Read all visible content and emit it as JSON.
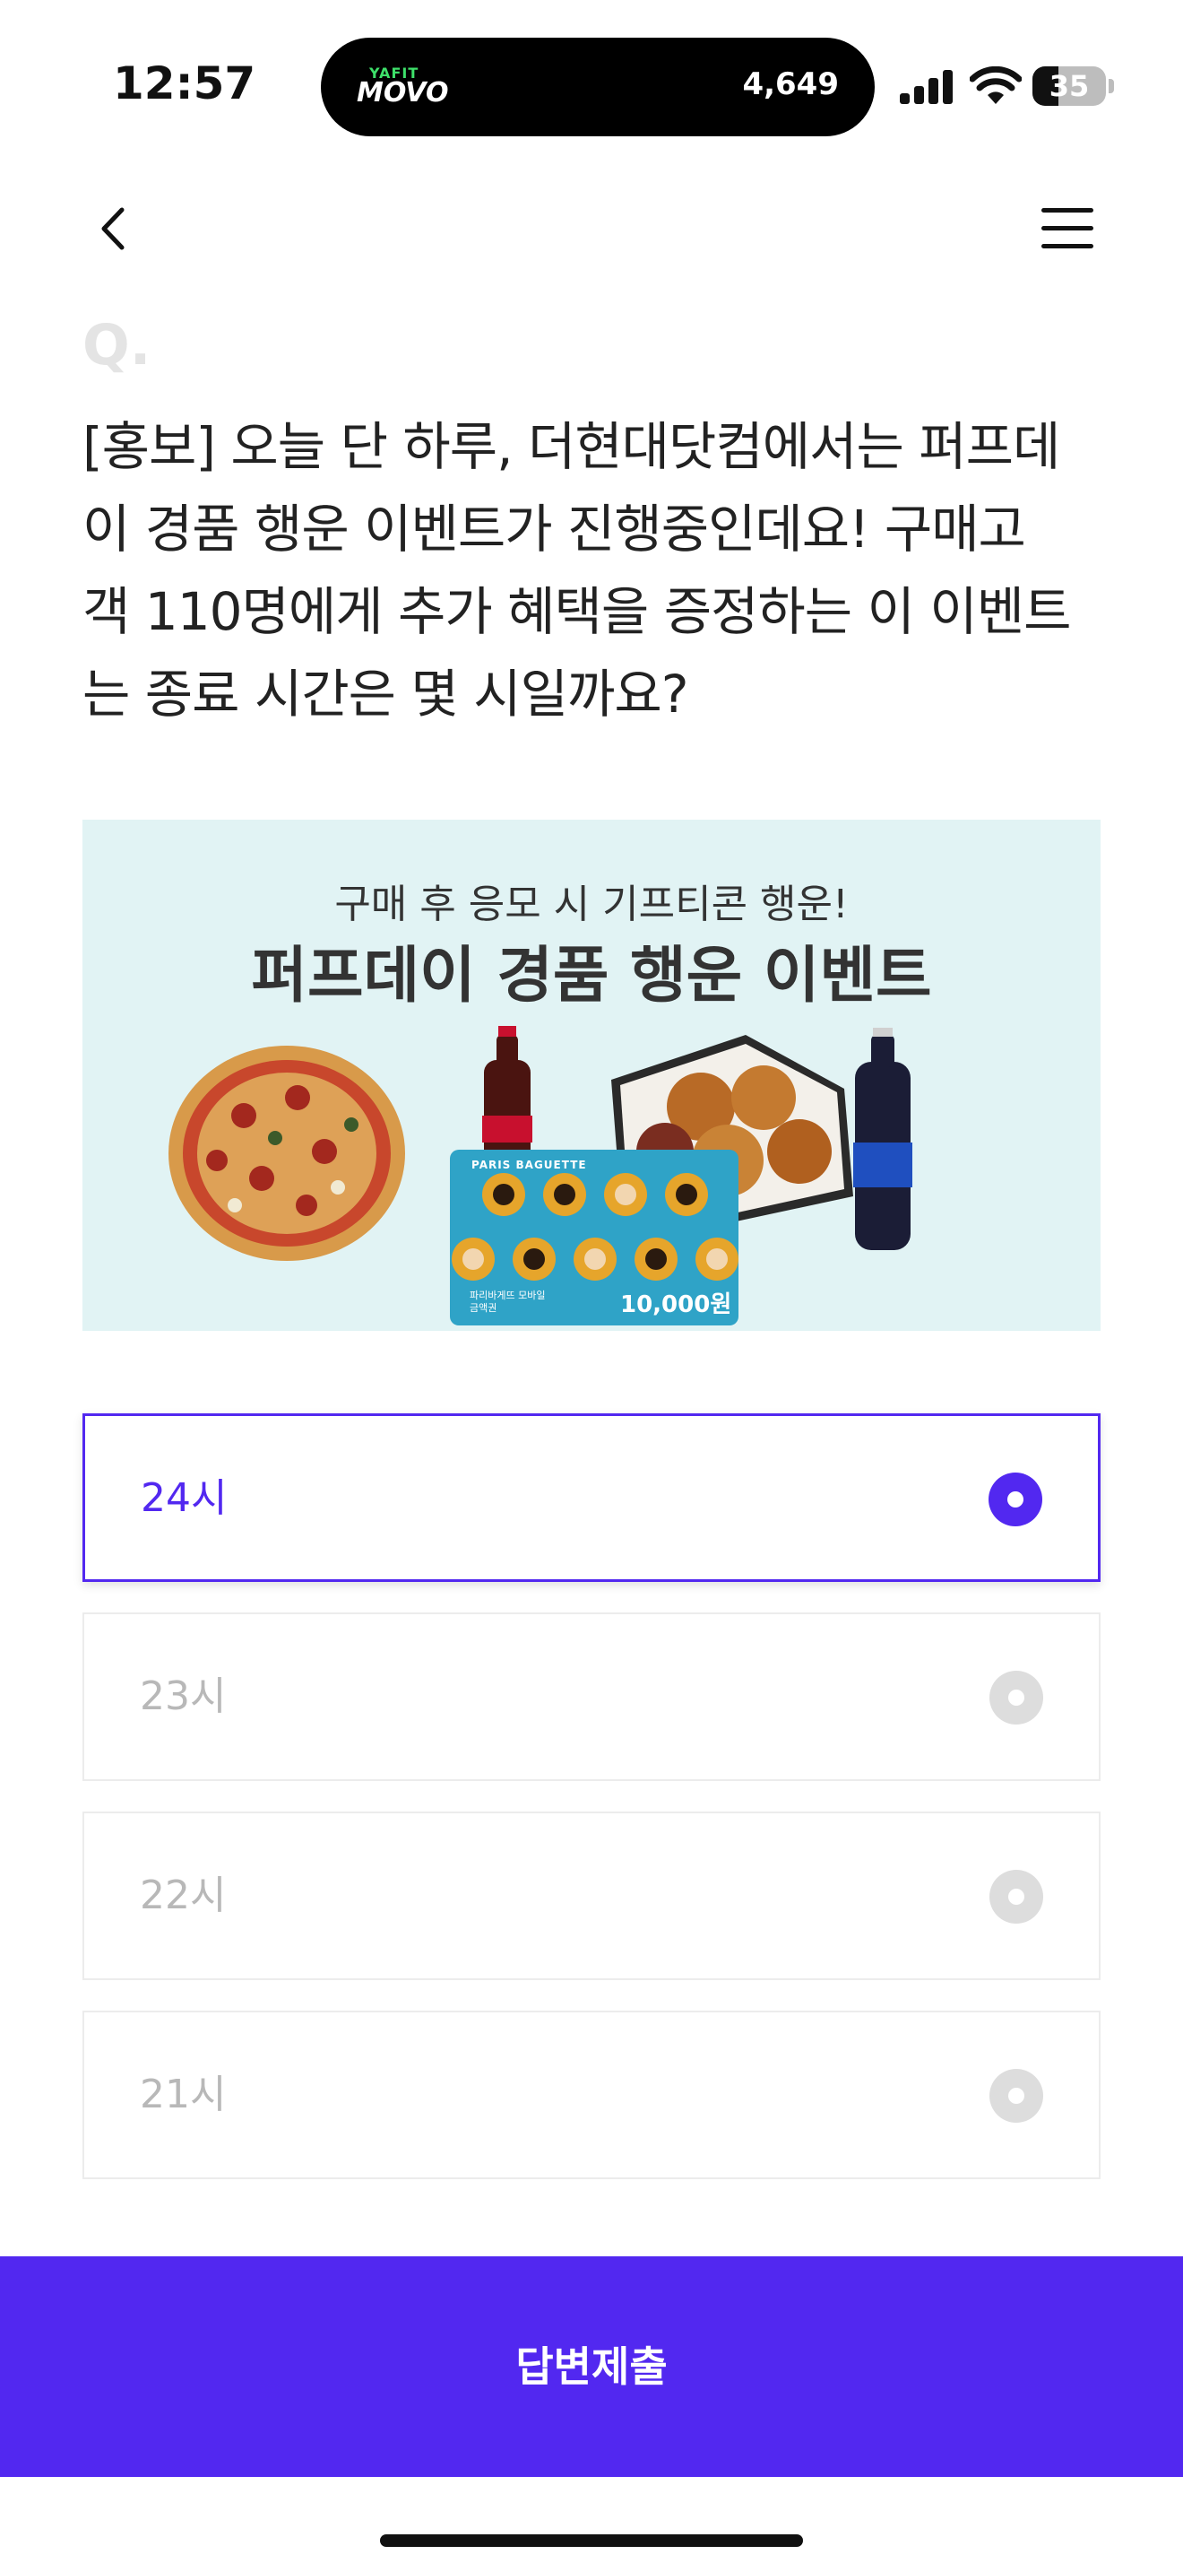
{
  "status_bar": {
    "time": "12:57",
    "island_app": {
      "badge": "YAFIT",
      "name": "MOVO"
    },
    "steps": "4,649",
    "battery_level": "35",
    "battery_fraction": 0.35
  },
  "nav": {
    "back_icon": "chevron-left-icon",
    "menu_icon": "hamburger-menu-icon"
  },
  "question": {
    "marker": "Q.",
    "lines": [
      "[홍보] 오늘 단 하루, 더현대닷컴에서는 퍼프데",
      "이 경품 행운 이벤트가 진행중인데요! 구매고",
      "객 110명에게 추가 혜택을 증정하는 이 이벤트",
      "는 종료 시간은 몇 시일까요?"
    ]
  },
  "banner": {
    "subtitle": "구매 후 응모 시 기프티콘 행운!",
    "title": "퍼프데이 경품 행운 이벤트",
    "voucher_brand": "PARIS BAGUETTE",
    "voucher_note": "파리바게뜨 모바일 금액권",
    "voucher_amount": "10,000원",
    "colors": {
      "background": "#e1f3f4",
      "voucher": "#2fa3c7"
    }
  },
  "options": [
    {
      "label": "24시",
      "selected": true
    },
    {
      "label": "23시",
      "selected": false
    },
    {
      "label": "22시",
      "selected": false
    },
    {
      "label": "21시",
      "selected": false
    }
  ],
  "submit": {
    "label": "답변제출"
  },
  "colors": {
    "accent": "#5228f0",
    "unselected": "#dddddd",
    "border": "#ececec"
  }
}
